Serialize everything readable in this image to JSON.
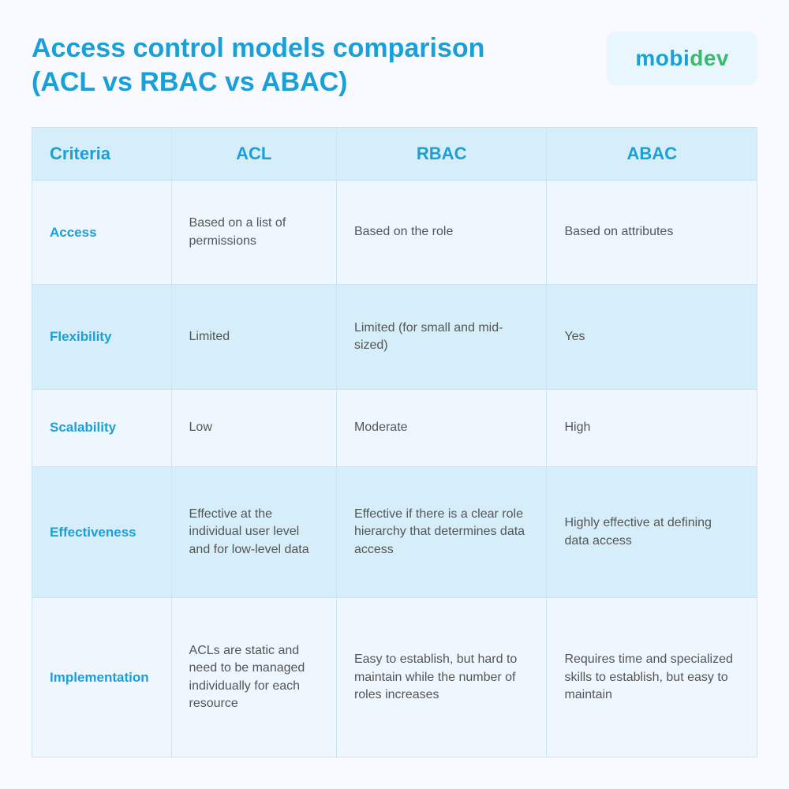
{
  "header": {
    "title": "Access control models comparison (ACL vs RBAC vs ABAC)",
    "logo": {
      "mobi": "mobi",
      "dev": "dev"
    }
  },
  "table": {
    "columns": [
      {
        "id": "criteria",
        "label": "Criteria"
      },
      {
        "id": "acl",
        "label": "ACL"
      },
      {
        "id": "rbac",
        "label": "RBAC"
      },
      {
        "id": "abac",
        "label": "ABAC"
      }
    ],
    "rows": [
      {
        "criteria": "Access",
        "acl": "Based on a list of permissions",
        "rbac": "Based on the role",
        "abac": "Based on attributes"
      },
      {
        "criteria": "Flexibility",
        "acl": "Limited",
        "rbac": "Limited (for small and mid-sized)",
        "abac": "Yes"
      },
      {
        "criteria": "Scalability",
        "acl": "Low",
        "rbac": "Moderate",
        "abac": "High"
      },
      {
        "criteria": "Effectiveness",
        "acl": "Effective at the individual user level and for low-level data",
        "rbac": "Effective if there is a clear role hierarchy that determines data access",
        "abac": "Highly effective at defining data access"
      },
      {
        "criteria": "Implementation",
        "acl": "ACLs are static and need to be managed individually for each resource",
        "rbac": "Easy to establish, but hard to maintain while the number of roles increases",
        "abac": "Requires time and specialized skills to establish, but easy to maintain"
      }
    ]
  }
}
